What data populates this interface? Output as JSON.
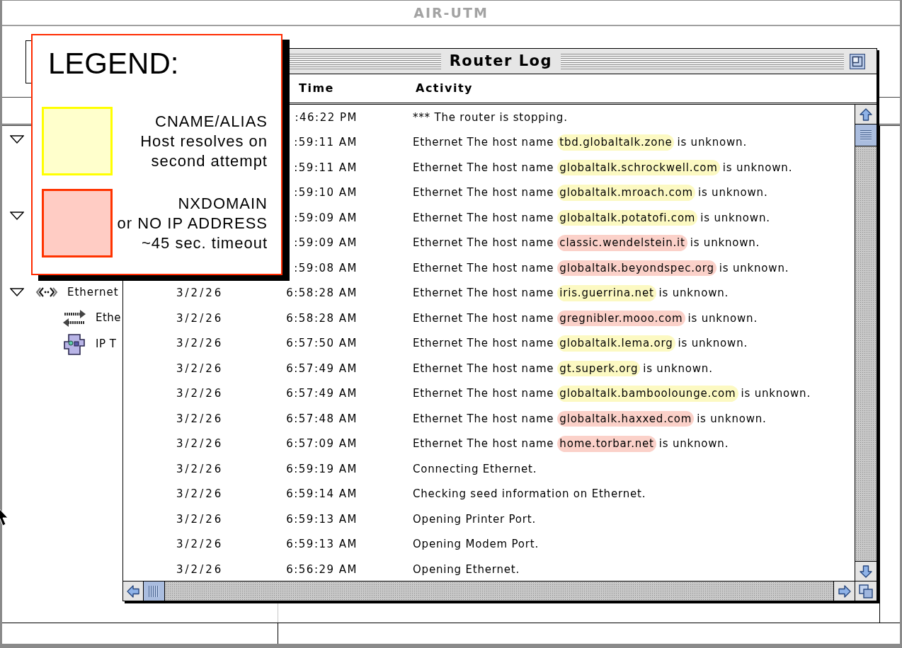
{
  "window": {
    "title": "AIR-UTM"
  },
  "sidebar": {
    "items": [
      {
        "expanded": true
      },
      {
        "expanded": true
      },
      {
        "kind": "network",
        "label": "Ethernet",
        "expanded": true,
        "children": [
          {
            "kind": "port",
            "label": "Ethe"
          },
          {
            "kind": "protocol",
            "label": "IP T"
          }
        ]
      }
    ]
  },
  "router_log": {
    "title": "Router Log",
    "columns": [
      {
        "label": "Time"
      },
      {
        "label": "Activity"
      }
    ],
    "rows": [
      {
        "time": ":46:22 PM",
        "activity": "*** The router is stopping."
      },
      {
        "time": ":59:11 AM",
        "activity": "Ethernet The host name",
        "host": {
          "text": "tbd.globaltalk.zone",
          "color": "#fcf9c2"
        },
        "activity_end": "is unknown."
      },
      {
        "time": ":59:11 AM",
        "activity": "Ethernet The host name",
        "host": {
          "text": "globaltalk.schrockwell.com",
          "color": "#fcf9c2"
        },
        "activity_end": "is unknown."
      },
      {
        "time": ":59:10 AM",
        "activity": "Ethernet The host name",
        "host": {
          "text": "globaltalk.mroach.com",
          "color": "#fcf9c2"
        },
        "activity_end": "is unknown."
      },
      {
        "time": ":59:09 AM",
        "activity": "Ethernet The host name",
        "host": {
          "text": "globaltalk.potatofi.com",
          "color": "#fcf9c2"
        },
        "activity_end": "is unknown."
      },
      {
        "time": ":59:09 AM",
        "activity": "Ethernet The host name",
        "host": {
          "text": "classic.wendelstein.it",
          "color": "#fbd1c9"
        },
        "activity_end": "is unknown."
      },
      {
        "time": ":59:08 AM",
        "activity": "Ethernet The host name",
        "host": {
          "text": "globaltalk.beyondspec.org",
          "color": "#fbd1c9"
        },
        "activity_end": "is unknown."
      },
      {
        "date": "3/2/26",
        "time": "6:58:28 AM",
        "activity": "Ethernet The host name",
        "host": {
          "text": "iris.guerrina.net",
          "color": "#fcf9c2"
        },
        "activity_end": "is unknown."
      },
      {
        "date": "3/2/26",
        "time": "6:58:28 AM",
        "activity": "Ethernet The host name",
        "host": {
          "text": "gregnibler.mooo.com",
          "color": "#fbd1c9"
        },
        "activity_end": "is unknown."
      },
      {
        "date": "3/2/26",
        "time": "6:57:50 AM",
        "activity": "Ethernet The host name",
        "host": {
          "text": "globaltalk.lema.org",
          "color": "#fcf9c2"
        },
        "activity_end": "is unknown."
      },
      {
        "date": "3/2/26",
        "time": "6:57:49 AM",
        "activity": "Ethernet The host name",
        "host": {
          "text": "gt.superk.org",
          "color": "#fcf9c2"
        },
        "activity_end": "is unknown."
      },
      {
        "date": "3/2/26",
        "time": "6:57:49 AM",
        "activity": "Ethernet The host name",
        "host": {
          "text": "globaltalk.bamboolounge.com",
          "color": "#fcf9c2"
        },
        "activity_end": "is unknown."
      },
      {
        "date": "3/2/26",
        "time": "6:57:48 AM",
        "activity": "Ethernet The host name",
        "host": {
          "text": "globaltalk.haxxed.com",
          "color": "#fbd1c9"
        },
        "activity_end": "is unknown."
      },
      {
        "date": "3/2/26",
        "time": "6:57:09 AM",
        "activity": "Ethernet The host name",
        "host": {
          "text": "home.torbar.net",
          "color": "#fbd1c9"
        },
        "activity_end": "is unknown."
      },
      {
        "date": "3/2/26",
        "time": "6:59:19 AM",
        "activity": "Connecting Ethernet."
      },
      {
        "date": "3/2/26",
        "time": "6:59:14 AM",
        "activity": "Checking seed information on Ethernet."
      },
      {
        "date": "3/2/26",
        "time": "6:59:13 AM",
        "activity": "Opening Printer Port."
      },
      {
        "date": "3/2/26",
        "time": "6:59:13 AM",
        "activity": "Opening Modem Port."
      },
      {
        "date": "3/2/26",
        "time": "6:56:29 AM",
        "activity": "Opening Ethernet."
      }
    ]
  },
  "legend": {
    "title": "LEGEND:",
    "items": [
      {
        "kind": "alias",
        "color": "#ffffcc",
        "lines": [
          "CNAME/ALIAS",
          "Host resolves on",
          "second attempt"
        ]
      },
      {
        "kind": "nxdomain",
        "color": "#ffccc4",
        "lines": [
          "NXDOMAIN",
          "or NO IP ADDRESS",
          "~45 sec. timeout"
        ]
      }
    ]
  }
}
